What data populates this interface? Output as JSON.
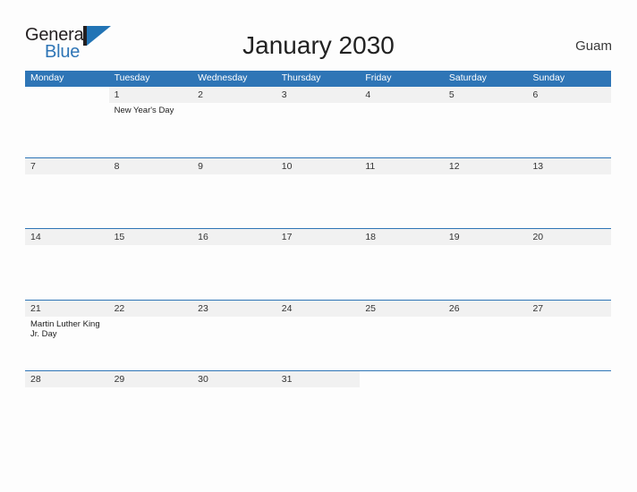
{
  "brand": {
    "name_part1": "General",
    "name_part2": "Blue",
    "logo_icon": "triangle-flag-icon"
  },
  "header": {
    "title": "January 2030",
    "location": "Guam"
  },
  "calendar": {
    "weekdays": [
      "Monday",
      "Tuesday",
      "Wednesday",
      "Thursday",
      "Friday",
      "Saturday",
      "Sunday"
    ],
    "colors": {
      "header_blue": "#2e75b6",
      "day_band_gray": "#f1f1f1",
      "page_background": "#fdfdfd",
      "brand_blue": "#2274b5",
      "text_dark": "#231f20"
    },
    "weeks": [
      {
        "days": [
          {
            "number": "",
            "in_month": false,
            "events": []
          },
          {
            "number": "1",
            "in_month": true,
            "events": [
              "New Year's Day"
            ]
          },
          {
            "number": "2",
            "in_month": true,
            "events": []
          },
          {
            "number": "3",
            "in_month": true,
            "events": []
          },
          {
            "number": "4",
            "in_month": true,
            "events": []
          },
          {
            "number": "5",
            "in_month": true,
            "events": []
          },
          {
            "number": "6",
            "in_month": true,
            "events": []
          }
        ]
      },
      {
        "days": [
          {
            "number": "7",
            "in_month": true,
            "events": []
          },
          {
            "number": "8",
            "in_month": true,
            "events": []
          },
          {
            "number": "9",
            "in_month": true,
            "events": []
          },
          {
            "number": "10",
            "in_month": true,
            "events": []
          },
          {
            "number": "11",
            "in_month": true,
            "events": []
          },
          {
            "number": "12",
            "in_month": true,
            "events": []
          },
          {
            "number": "13",
            "in_month": true,
            "events": []
          }
        ]
      },
      {
        "days": [
          {
            "number": "14",
            "in_month": true,
            "events": []
          },
          {
            "number": "15",
            "in_month": true,
            "events": []
          },
          {
            "number": "16",
            "in_month": true,
            "events": []
          },
          {
            "number": "17",
            "in_month": true,
            "events": []
          },
          {
            "number": "18",
            "in_month": true,
            "events": []
          },
          {
            "number": "19",
            "in_month": true,
            "events": []
          },
          {
            "number": "20",
            "in_month": true,
            "events": []
          }
        ]
      },
      {
        "days": [
          {
            "number": "21",
            "in_month": true,
            "events": [
              "Martin Luther King Jr. Day"
            ]
          },
          {
            "number": "22",
            "in_month": true,
            "events": []
          },
          {
            "number": "23",
            "in_month": true,
            "events": []
          },
          {
            "number": "24",
            "in_month": true,
            "events": []
          },
          {
            "number": "25",
            "in_month": true,
            "events": []
          },
          {
            "number": "26",
            "in_month": true,
            "events": []
          },
          {
            "number": "27",
            "in_month": true,
            "events": []
          }
        ]
      },
      {
        "last": true,
        "days": [
          {
            "number": "28",
            "in_month": true,
            "events": []
          },
          {
            "number": "29",
            "in_month": true,
            "events": []
          },
          {
            "number": "30",
            "in_month": true,
            "events": []
          },
          {
            "number": "31",
            "in_month": true,
            "events": []
          },
          {
            "number": "",
            "in_month": false,
            "events": []
          },
          {
            "number": "",
            "in_month": false,
            "events": []
          },
          {
            "number": "",
            "in_month": false,
            "events": []
          }
        ]
      }
    ]
  }
}
